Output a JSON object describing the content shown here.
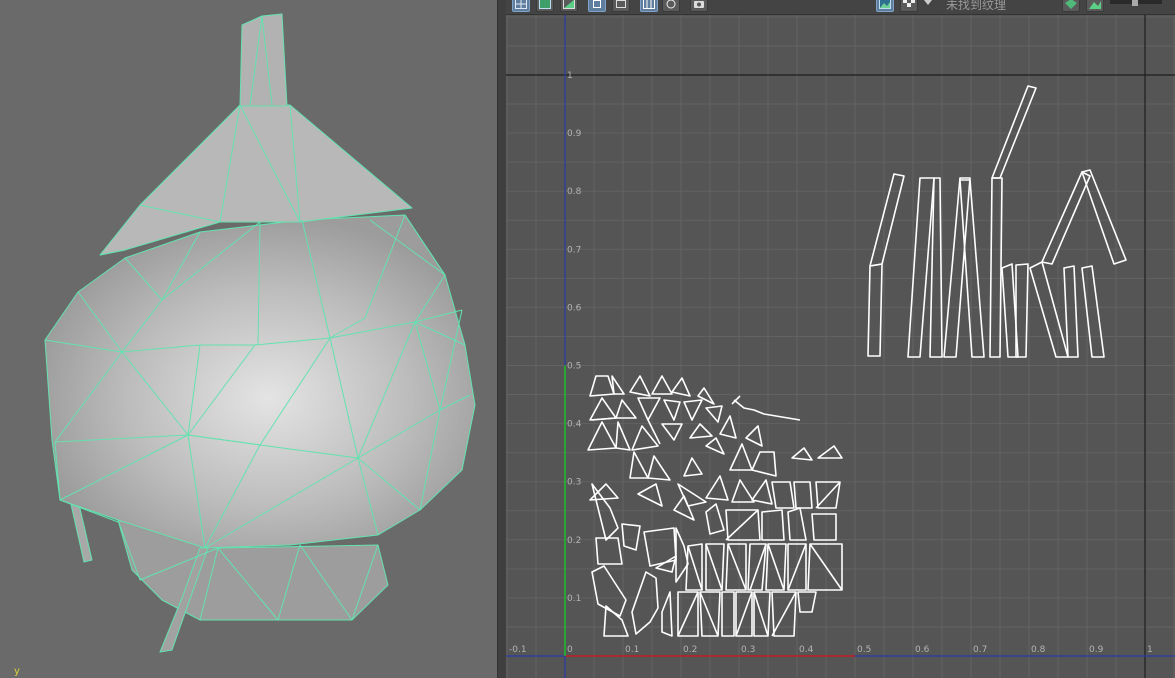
{
  "viewport": {
    "axis_label": "y",
    "wire_color": "#64e2b0"
  },
  "uv_toolbar": {
    "texture_status": "未找到纹理",
    "buttons": [
      "uv-grid-icon",
      "shaded-uv-icon",
      "texture-border-icon",
      "select-uv-icon",
      "frame-icon",
      "grid-toggle-icon",
      "tile-icon",
      "snapshot-icon",
      "checker-icon",
      "dropdown-icon",
      "image-icon",
      "render-icon",
      "exposure-slider"
    ]
  },
  "uv_editor": {
    "x_ticks": [
      "-0.1",
      "0",
      "0.1",
      "0.2",
      "0.3",
      "0.4",
      "0.5",
      "0.6",
      "0.7",
      "0.8",
      "0.9",
      "1"
    ],
    "y_ticks": [
      "0.1",
      "0.2",
      "0.3",
      "0.4",
      "0.5",
      "0.6",
      "0.7",
      "0.8",
      "0.9",
      "1"
    ],
    "grid_color": "#626262",
    "frame_color": "#1e1e1e",
    "u_axis_color": "#c81e1e",
    "v_axis_color": "#1ec81e",
    "uv_shell_color": "#ffffff"
  }
}
